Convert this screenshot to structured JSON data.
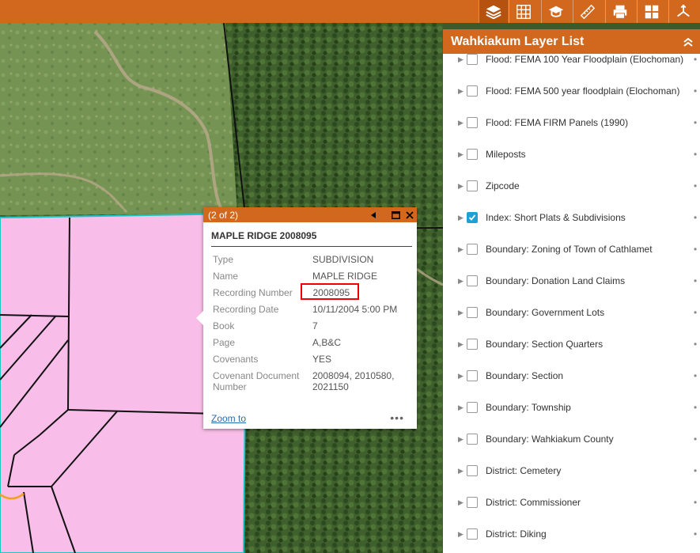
{
  "toolbar": {
    "buttons": [
      {
        "name": "layers-icon",
        "active": true
      },
      {
        "name": "basemap-grid-icon",
        "active": false
      },
      {
        "name": "legend-icon",
        "active": false
      },
      {
        "name": "measure-ruler-icon",
        "active": false
      },
      {
        "name": "print-icon",
        "active": false
      },
      {
        "name": "widgets-grid-icon",
        "active": false
      },
      {
        "name": "share-icon",
        "active": false
      }
    ]
  },
  "popup": {
    "pager": "(2 of 2)",
    "title": "MAPLE RIDGE 2008095",
    "attributes": [
      {
        "key": "Type",
        "value": "SUBDIVISION"
      },
      {
        "key": "Name",
        "value": "MAPLE RIDGE"
      },
      {
        "key": "Recording Number",
        "value": "2008095"
      },
      {
        "key": "Recording Date",
        "value": "10/11/2004 5:00 PM"
      },
      {
        "key": "Book",
        "value": "7"
      },
      {
        "key": "Page",
        "value": "A,B&C"
      },
      {
        "key": "Covenants",
        "value": "YES"
      },
      {
        "key": "Covenant Document Number",
        "value": "2008094, 2010580, 2021150"
      }
    ],
    "zoom_label": "Zoom to",
    "more_label": "•••"
  },
  "layer_panel": {
    "title": "Wahkiakum Layer List",
    "layers": [
      {
        "label": "Flood: FEMA 100 Year Floodplain (Elochoman)",
        "checked": false
      },
      {
        "label": "Flood: FEMA 500 year floodplain (Elochoman)",
        "checked": false
      },
      {
        "label": "Flood: FEMA FIRM Panels (1990)",
        "checked": false
      },
      {
        "label": "Mileposts",
        "checked": false
      },
      {
        "label": "Zipcode",
        "checked": false
      },
      {
        "label": "Index: Short Plats & Subdivisions",
        "checked": true
      },
      {
        "label": "Boundary: Zoning of Town of Cathlamet",
        "checked": false
      },
      {
        "label": "Boundary: Donation Land Claims",
        "checked": false
      },
      {
        "label": "Boundary: Government Lots",
        "checked": false
      },
      {
        "label": "Boundary: Section Quarters",
        "checked": false
      },
      {
        "label": "Boundary: Section",
        "checked": false
      },
      {
        "label": "Boundary: Township",
        "checked": false
      },
      {
        "label": "Boundary: Wahkiakum County",
        "checked": false
      },
      {
        "label": "District: Cemetery",
        "checked": false
      },
      {
        "label": "District: Commissioner",
        "checked": false
      },
      {
        "label": "District: Diking",
        "checked": false
      }
    ]
  },
  "colors": {
    "accent": "#d2681e",
    "parcel_fill": "#f8bde8",
    "highlight_border": "#e00000",
    "checkbox_checked": "#1ba1d6"
  }
}
